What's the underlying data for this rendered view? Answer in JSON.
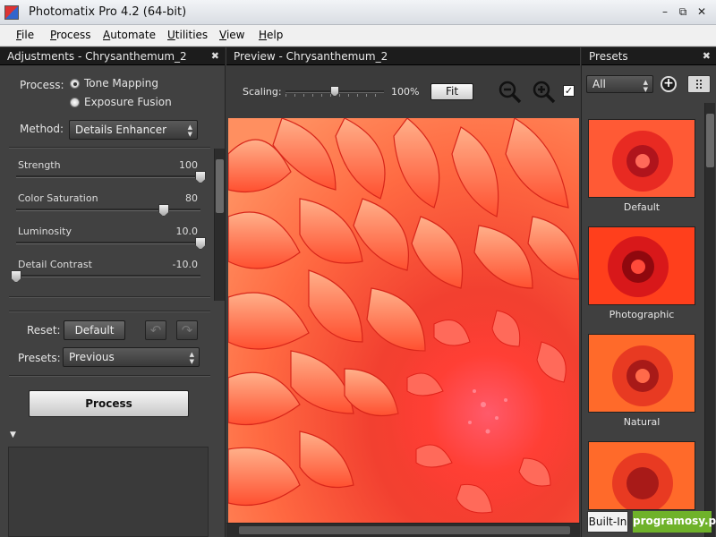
{
  "window": {
    "title": "Photomatix Pro 4.2 (64-bit)",
    "min": "–",
    "max": "⧉",
    "close": "✕"
  },
  "menu": [
    {
      "u": "F",
      "rest": "ile"
    },
    {
      "u": "P",
      "rest": "rocess"
    },
    {
      "u": "A",
      "rest": "utomate"
    },
    {
      "u": "U",
      "rest": "tilities"
    },
    {
      "u": "V",
      "rest": "iew"
    },
    {
      "u": "H",
      "rest": "elp"
    }
  ],
  "left": {
    "title": "Adjustments - Chrysanthemum_2",
    "close": "✖",
    "process_label": "Process:",
    "tone_mapping": "Tone Mapping",
    "exposure_fusion": "Exposure Fusion",
    "method_label": "Method:",
    "method_value": "Details Enhancer",
    "sliders": [
      {
        "label": "Strength",
        "value": "100",
        "level": 1.0
      },
      {
        "label": "Color Saturation",
        "value": "80",
        "level": 0.8
      },
      {
        "label": "Luminosity",
        "value": "10.0",
        "level": 1.0
      },
      {
        "label": "Detail Contrast",
        "value": "-10.0",
        "level": 0.0
      }
    ],
    "reset_label": "Reset:",
    "default_btn": "Default",
    "presets_label": "Presets:",
    "presets_value": "Previous",
    "process_btn": "Process",
    "collapse_arrow": "▼"
  },
  "center": {
    "title": "Preview - Chrysanthemum_2",
    "scaling_label": "Scaling:",
    "scaling_value": "100%",
    "scaling_level": 0.5,
    "fit_btn": "Fit",
    "checkbox": "✓"
  },
  "right": {
    "title": "Presets",
    "close": "✖",
    "filter_value": "All",
    "add": "+",
    "presets": [
      {
        "name": "Default"
      },
      {
        "name": "Photographic"
      },
      {
        "name": "Natural"
      },
      {
        "name": ""
      }
    ],
    "tab_builtin": "Built-In",
    "watermark": "programosy.pl"
  },
  "colors": {
    "petal_light": "#ff8a5a",
    "petal_dark": "#e0221a",
    "center": "#ff4036"
  }
}
